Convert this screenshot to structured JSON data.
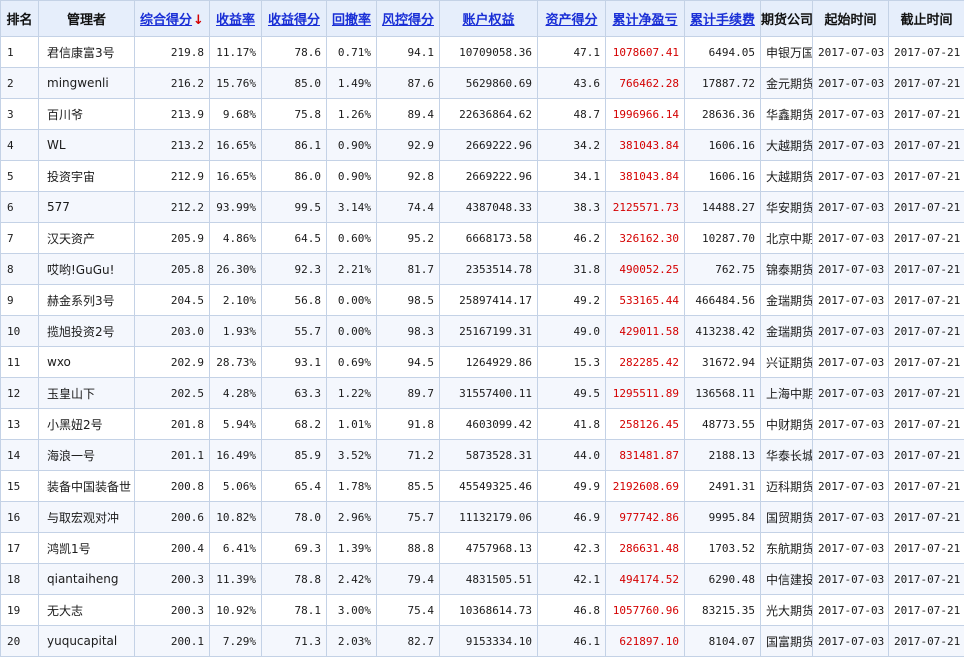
{
  "colors": {
    "header_bg": "#e6eefb",
    "border": "#c4d2e6",
    "link": "#1a2fd6",
    "negative": "#d40000",
    "alt_row": "#f4f7fd"
  },
  "headers": {
    "rank": "排名",
    "manager": "管理者",
    "composite": "综合得分",
    "sort_icon": "↓",
    "return_rate": "收益率",
    "return_score": "收益得分",
    "drawdown": "回撤率",
    "risk_score": "风控得分",
    "equity": "账户权益",
    "asset_score": "资产得分",
    "pnl": "累计净盈亏",
    "fee": "累计手续费",
    "company": "期货公司",
    "start": "起始时间",
    "end": "截止时间"
  },
  "rows": [
    {
      "rank": "1",
      "manager": "君信康富3号",
      "composite": "219.8",
      "return_rate": "11.17%",
      "return_score": "78.6",
      "drawdown": "0.71%",
      "risk_score": "94.1",
      "equity": "10709058.36",
      "asset_score": "47.1",
      "pnl": "1078607.41",
      "fee": "6494.05",
      "company": "申银万国",
      "start": "2017-07-03",
      "end": "2017-07-21"
    },
    {
      "rank": "2",
      "manager": "mingwenli",
      "composite": "216.2",
      "return_rate": "15.76%",
      "return_score": "85.0",
      "drawdown": "1.49%",
      "risk_score": "87.6",
      "equity": "5629860.69",
      "asset_score": "43.6",
      "pnl": "766462.28",
      "fee": "17887.72",
      "company": "金元期货",
      "start": "2017-07-03",
      "end": "2017-07-21"
    },
    {
      "rank": "3",
      "manager": "百川爷",
      "composite": "213.9",
      "return_rate": "9.68%",
      "return_score": "75.8",
      "drawdown": "1.26%",
      "risk_score": "89.4",
      "equity": "22636864.62",
      "asset_score": "48.7",
      "pnl": "1996966.14",
      "fee": "28636.36",
      "company": "华鑫期货",
      "start": "2017-07-03",
      "end": "2017-07-21"
    },
    {
      "rank": "4",
      "manager": "WL",
      "composite": "213.2",
      "return_rate": "16.65%",
      "return_score": "86.1",
      "drawdown": "0.90%",
      "risk_score": "92.9",
      "equity": "2669222.96",
      "asset_score": "34.2",
      "pnl": "381043.84",
      "fee": "1606.16",
      "company": "大越期货",
      "start": "2017-07-03",
      "end": "2017-07-21"
    },
    {
      "rank": "5",
      "manager": "投资宇宙",
      "composite": "212.9",
      "return_rate": "16.65%",
      "return_score": "86.0",
      "drawdown": "0.90%",
      "risk_score": "92.8",
      "equity": "2669222.96",
      "asset_score": "34.1",
      "pnl": "381043.84",
      "fee": "1606.16",
      "company": "大越期货",
      "start": "2017-07-03",
      "end": "2017-07-21"
    },
    {
      "rank": "6",
      "manager": "577",
      "composite": "212.2",
      "return_rate": "93.99%",
      "return_score": "99.5",
      "drawdown": "3.14%",
      "risk_score": "74.4",
      "equity": "4387048.33",
      "asset_score": "38.3",
      "pnl": "2125571.73",
      "fee": "14488.27",
      "company": "华安期货",
      "start": "2017-07-03",
      "end": "2017-07-21"
    },
    {
      "rank": "7",
      "manager": "汉天资产",
      "composite": "205.9",
      "return_rate": "4.86%",
      "return_score": "64.5",
      "drawdown": "0.60%",
      "risk_score": "95.2",
      "equity": "6668173.58",
      "asset_score": "46.2",
      "pnl": "326162.30",
      "fee": "10287.70",
      "company": "北京中期",
      "start": "2017-07-03",
      "end": "2017-07-21"
    },
    {
      "rank": "8",
      "manager": "哎哟!GuGu!",
      "composite": "205.8",
      "return_rate": "26.30%",
      "return_score": "92.3",
      "drawdown": "2.21%",
      "risk_score": "81.7",
      "equity": "2353514.78",
      "asset_score": "31.8",
      "pnl": "490052.25",
      "fee": "762.75",
      "company": "锦泰期货",
      "start": "2017-07-03",
      "end": "2017-07-21"
    },
    {
      "rank": "9",
      "manager": "赫金系列3号",
      "composite": "204.5",
      "return_rate": "2.10%",
      "return_score": "56.8",
      "drawdown": "0.00%",
      "risk_score": "98.5",
      "equity": "25897414.17",
      "asset_score": "49.2",
      "pnl": "533165.44",
      "fee": "466484.56",
      "company": "金瑞期货",
      "start": "2017-07-03",
      "end": "2017-07-21"
    },
    {
      "rank": "10",
      "manager": "揽旭投资2号",
      "composite": "203.0",
      "return_rate": "1.93%",
      "return_score": "55.7",
      "drawdown": "0.00%",
      "risk_score": "98.3",
      "equity": "25167199.31",
      "asset_score": "49.0",
      "pnl": "429011.58",
      "fee": "413238.42",
      "company": "金瑞期货",
      "start": "2017-07-03",
      "end": "2017-07-21"
    },
    {
      "rank": "11",
      "manager": "wxo",
      "composite": "202.9",
      "return_rate": "28.73%",
      "return_score": "93.1",
      "drawdown": "0.69%",
      "risk_score": "94.5",
      "equity": "1264929.86",
      "asset_score": "15.3",
      "pnl": "282285.42",
      "fee": "31672.94",
      "company": "兴证期货",
      "start": "2017-07-03",
      "end": "2017-07-21"
    },
    {
      "rank": "12",
      "manager": "玉皇山下",
      "composite": "202.5",
      "return_rate": "4.28%",
      "return_score": "63.3",
      "drawdown": "1.22%",
      "risk_score": "89.7",
      "equity": "31557400.11",
      "asset_score": "49.5",
      "pnl": "1295511.89",
      "fee": "136568.11",
      "company": "上海中期",
      "start": "2017-07-03",
      "end": "2017-07-21"
    },
    {
      "rank": "13",
      "manager": "小黑妞2号",
      "composite": "201.8",
      "return_rate": "5.94%",
      "return_score": "68.2",
      "drawdown": "1.01%",
      "risk_score": "91.8",
      "equity": "4603099.42",
      "asset_score": "41.8",
      "pnl": "258126.45",
      "fee": "48773.55",
      "company": "中财期货",
      "start": "2017-07-03",
      "end": "2017-07-21"
    },
    {
      "rank": "14",
      "manager": "海浪一号",
      "composite": "201.1",
      "return_rate": "16.49%",
      "return_score": "85.9",
      "drawdown": "3.52%",
      "risk_score": "71.2",
      "equity": "5873528.31",
      "asset_score": "44.0",
      "pnl": "831481.87",
      "fee": "2188.13",
      "company": "华泰长城",
      "start": "2017-07-03",
      "end": "2017-07-21"
    },
    {
      "rank": "15",
      "manager": "装备中国装备世",
      "composite": "200.8",
      "return_rate": "5.06%",
      "return_score": "65.4",
      "drawdown": "1.78%",
      "risk_score": "85.5",
      "equity": "45549325.46",
      "asset_score": "49.9",
      "pnl": "2192608.69",
      "fee": "2491.31",
      "company": "迈科期货",
      "start": "2017-07-03",
      "end": "2017-07-21"
    },
    {
      "rank": "16",
      "manager": "与取宏观对冲",
      "composite": "200.6",
      "return_rate": "10.82%",
      "return_score": "78.0",
      "drawdown": "2.96%",
      "risk_score": "75.7",
      "equity": "11132179.06",
      "asset_score": "46.9",
      "pnl": "977742.86",
      "fee": "9995.84",
      "company": "国贸期货",
      "start": "2017-07-03",
      "end": "2017-07-21"
    },
    {
      "rank": "17",
      "manager": "鸿凯1号",
      "composite": "200.4",
      "return_rate": "6.41%",
      "return_score": "69.3",
      "drawdown": "1.39%",
      "risk_score": "88.8",
      "equity": "4757968.13",
      "asset_score": "42.3",
      "pnl": "286631.48",
      "fee": "1703.52",
      "company": "东航期货",
      "start": "2017-07-03",
      "end": "2017-07-21"
    },
    {
      "rank": "18",
      "manager": "qiantaiheng",
      "composite": "200.3",
      "return_rate": "11.39%",
      "return_score": "78.8",
      "drawdown": "2.42%",
      "risk_score": "79.4",
      "equity": "4831505.51",
      "asset_score": "42.1",
      "pnl": "494174.52",
      "fee": "6290.48",
      "company": "中信建投",
      "start": "2017-07-03",
      "end": "2017-07-21"
    },
    {
      "rank": "19",
      "manager": "无大志",
      "composite": "200.3",
      "return_rate": "10.92%",
      "return_score": "78.1",
      "drawdown": "3.00%",
      "risk_score": "75.4",
      "equity": "10368614.73",
      "asset_score": "46.8",
      "pnl": "1057760.96",
      "fee": "83215.35",
      "company": "光大期货",
      "start": "2017-07-03",
      "end": "2017-07-21"
    },
    {
      "rank": "20",
      "manager": "yuqucapital",
      "composite": "200.1",
      "return_rate": "7.29%",
      "return_score": "71.3",
      "drawdown": "2.03%",
      "risk_score": "82.7",
      "equity": "9153334.10",
      "asset_score": "46.1",
      "pnl": "621897.10",
      "fee": "8104.07",
      "company": "国富期货",
      "start": "2017-07-03",
      "end": "2017-07-21"
    }
  ]
}
